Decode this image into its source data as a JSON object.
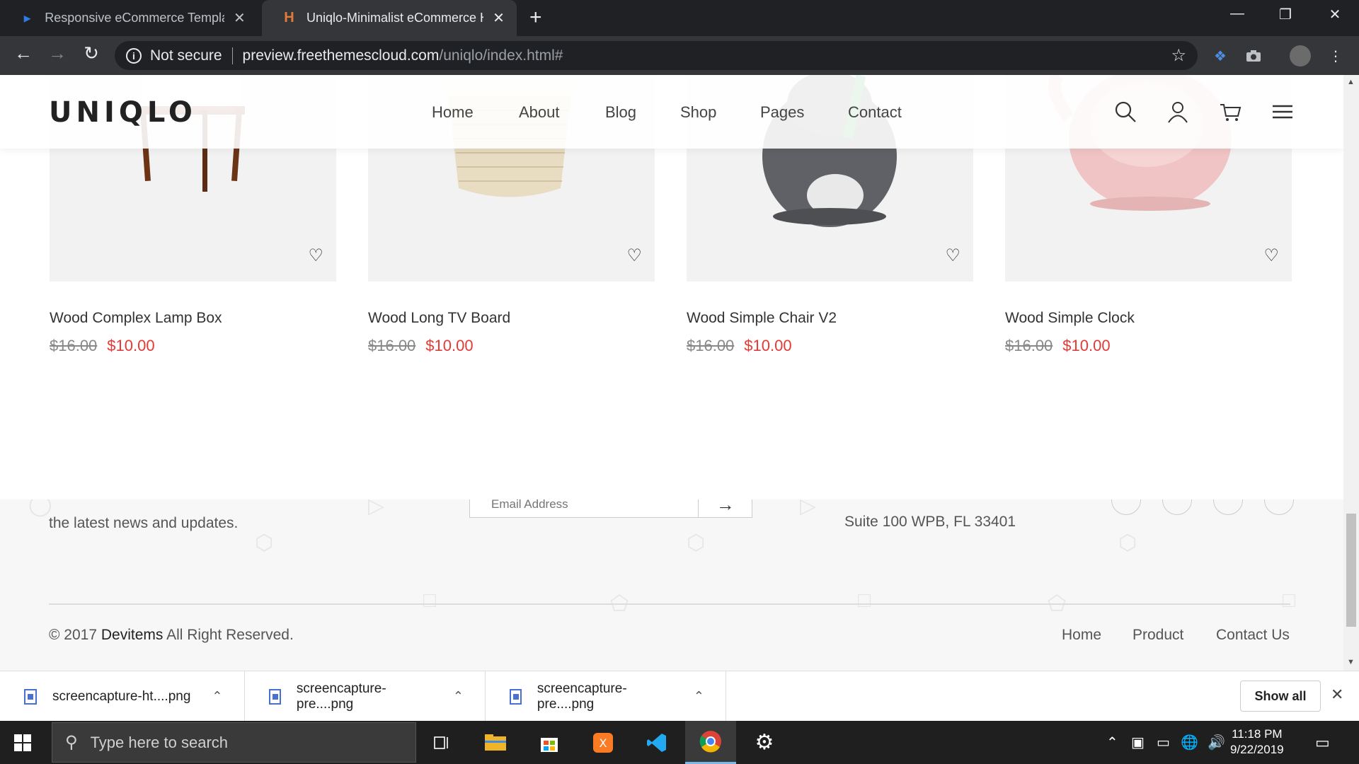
{
  "browser": {
    "tabs": [
      {
        "title": "Responsive eCommerce Templates",
        "favicon": "bing-icon"
      },
      {
        "title": "Uniqlo-Minimalist eCommerce HTML",
        "favicon": "h-icon"
      }
    ],
    "security_label": "Not secure",
    "url_host": "preview.freethemescloud.com",
    "url_path": "/uniqlo/index.html#"
  },
  "site": {
    "logo": "UNIQLO",
    "menu": [
      "Home",
      "About",
      "Blog",
      "Shop",
      "Pages",
      "Contact"
    ]
  },
  "products": [
    {
      "name": "Wood Complex Lamp Box",
      "old_price": "$16.00",
      "price": "$10.00"
    },
    {
      "name": "Wood Long TV Board",
      "old_price": "$16.00",
      "price": "$10.00"
    },
    {
      "name": "Wood Simple Chair V2",
      "old_price": "$16.00",
      "price": "$10.00"
    },
    {
      "name": "Wood Simple Clock",
      "old_price": "$16.00",
      "price": "$10.00"
    }
  ],
  "footer": {
    "newsletter_text": "the latest news and updates.",
    "email_placeholder": "Email Address",
    "address_line": "Suite 100 WPB, FL 33401",
    "copyright_prefix": "© 2017 ",
    "copyright_brand": "Devitems",
    "copyright_suffix": " All Right Reserved.",
    "links": [
      "Home",
      "Product",
      "Contact Us"
    ]
  },
  "downloads": {
    "items": [
      "screencapture-ht....png",
      "screencapture-pre....png",
      "screencapture-pre....png"
    ],
    "show_all": "Show all"
  },
  "taskbar": {
    "search_placeholder": "Type here to search",
    "time": "11:18 PM",
    "date": "9/22/2019"
  },
  "colors": {
    "accent_price": "#e53935",
    "chrome_dark": "#202124",
    "chrome_toolbar": "#35363a"
  }
}
